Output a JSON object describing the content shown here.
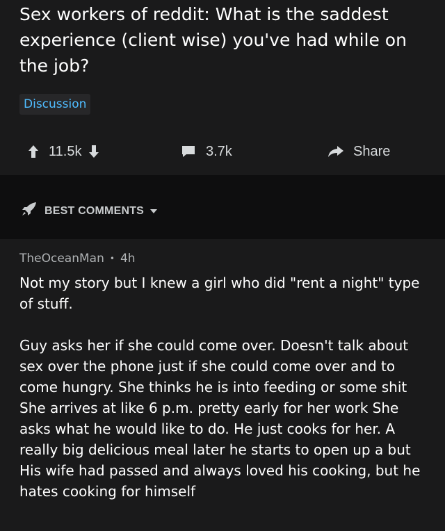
{
  "post": {
    "title": "Sex workers of reddit: What is the saddest experience (client wise) you've had while on the job?",
    "flair": "Discussion",
    "upvotes": "11.5k",
    "comments_count": "3.7k",
    "share_label": "Share"
  },
  "sort": {
    "label": "BEST COMMENTS"
  },
  "comment": {
    "author": "TheOceanMan",
    "separator": "•",
    "age": "4h",
    "paragraphs": [
      "Not my story but I knew a girl who did \"rent a night\" type of stuff.",
      "Guy asks her if she could come over. Doesn't talk about sex over the phone just if she could come over and to come hungry. She thinks he is into feeding or some shit She arrives at like 6 p.m. pretty early for her work She asks what he would like to do. He just cooks for her. A really big delicious meal later he starts to open up a but His wife had passed and always loved his cooking, but he hates cooking for himself"
    ]
  },
  "colors": {
    "background": "#1a1a1b",
    "sortbar": "#0e0e0f",
    "flair_text": "#4fbcff",
    "text": "#ffffff"
  },
  "icons": [
    "upvote-icon",
    "downvote-icon",
    "comment-icon",
    "share-icon",
    "rocket-icon",
    "chevron-down-icon"
  ]
}
